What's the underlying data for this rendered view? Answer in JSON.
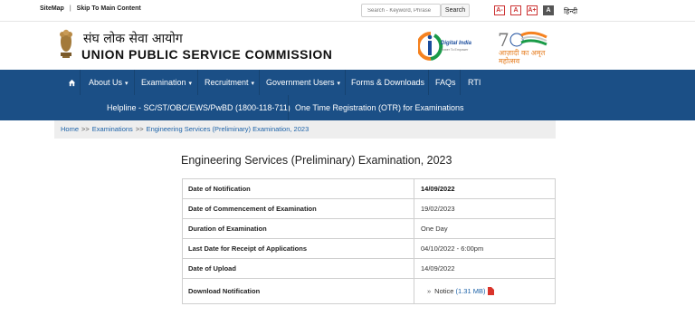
{
  "topbar": {
    "sitemap": "SiteMap",
    "separator": "|",
    "skip": "Skip To Main Content",
    "search_placeholder": "Search - Keyword, Phrase",
    "search_button": "Search",
    "font_decrease": "A-",
    "font_normal": "A",
    "font_increase": "A+",
    "font_contrast": "A",
    "language": "हिन्दी"
  },
  "header": {
    "hindi_title": "संघ लोक सेवा आयोग",
    "title": "UNION PUBLIC SERVICE COMMISSION",
    "digital_india": "Digital India",
    "digital_india_tagline": "Power To Empower",
    "azadi_text": "आज़ादी का अमृत महोत्सव"
  },
  "nav": {
    "row1": [
      {
        "label": "About Us",
        "dropdown": true
      },
      {
        "label": "Examination",
        "dropdown": true
      },
      {
        "label": "Recruitment",
        "dropdown": true
      },
      {
        "label": "Government Users",
        "dropdown": true
      },
      {
        "label": "Forms & Downloads",
        "dropdown": false
      },
      {
        "label": "FAQs",
        "dropdown": false
      },
      {
        "label": "RTI",
        "dropdown": false
      }
    ],
    "row2": [
      {
        "label": "Helpline - SC/ST/OBC/EWS/PwBD (1800-118-711)"
      },
      {
        "label": "One Time Registration (OTR) for Examinations"
      }
    ],
    "caret": "▾",
    "home_icon": "home-icon"
  },
  "breadcrumb": {
    "home": "Home",
    "sep": ">>",
    "examinations": "Examinations",
    "current": "Engineering Services (Preliminary) Examination, 2023"
  },
  "exam": {
    "title": "Engineering Services (Preliminary) Examination, 2023",
    "rows": [
      {
        "label": "Date of Notification",
        "value": "14/09/2022"
      },
      {
        "label": "Date of Commencement of Examination",
        "value": "19/02/2023"
      },
      {
        "label": "Duration of Examination",
        "value": "One Day"
      },
      {
        "label": "Last Date for Receipt of Applications",
        "value": "04/10/2022 - 6:00pm"
      },
      {
        "label": "Date of Upload",
        "value": "14/09/2022"
      }
    ],
    "download": {
      "label": "Download Notification",
      "arrow": "»",
      "link_text": "Notice",
      "size": "(1.31 MB)"
    }
  },
  "colors": {
    "nav_bg": "#1b4f86",
    "link": "#1c62a8",
    "font_button": "#cc3333",
    "pdf_red": "#d9342b"
  }
}
